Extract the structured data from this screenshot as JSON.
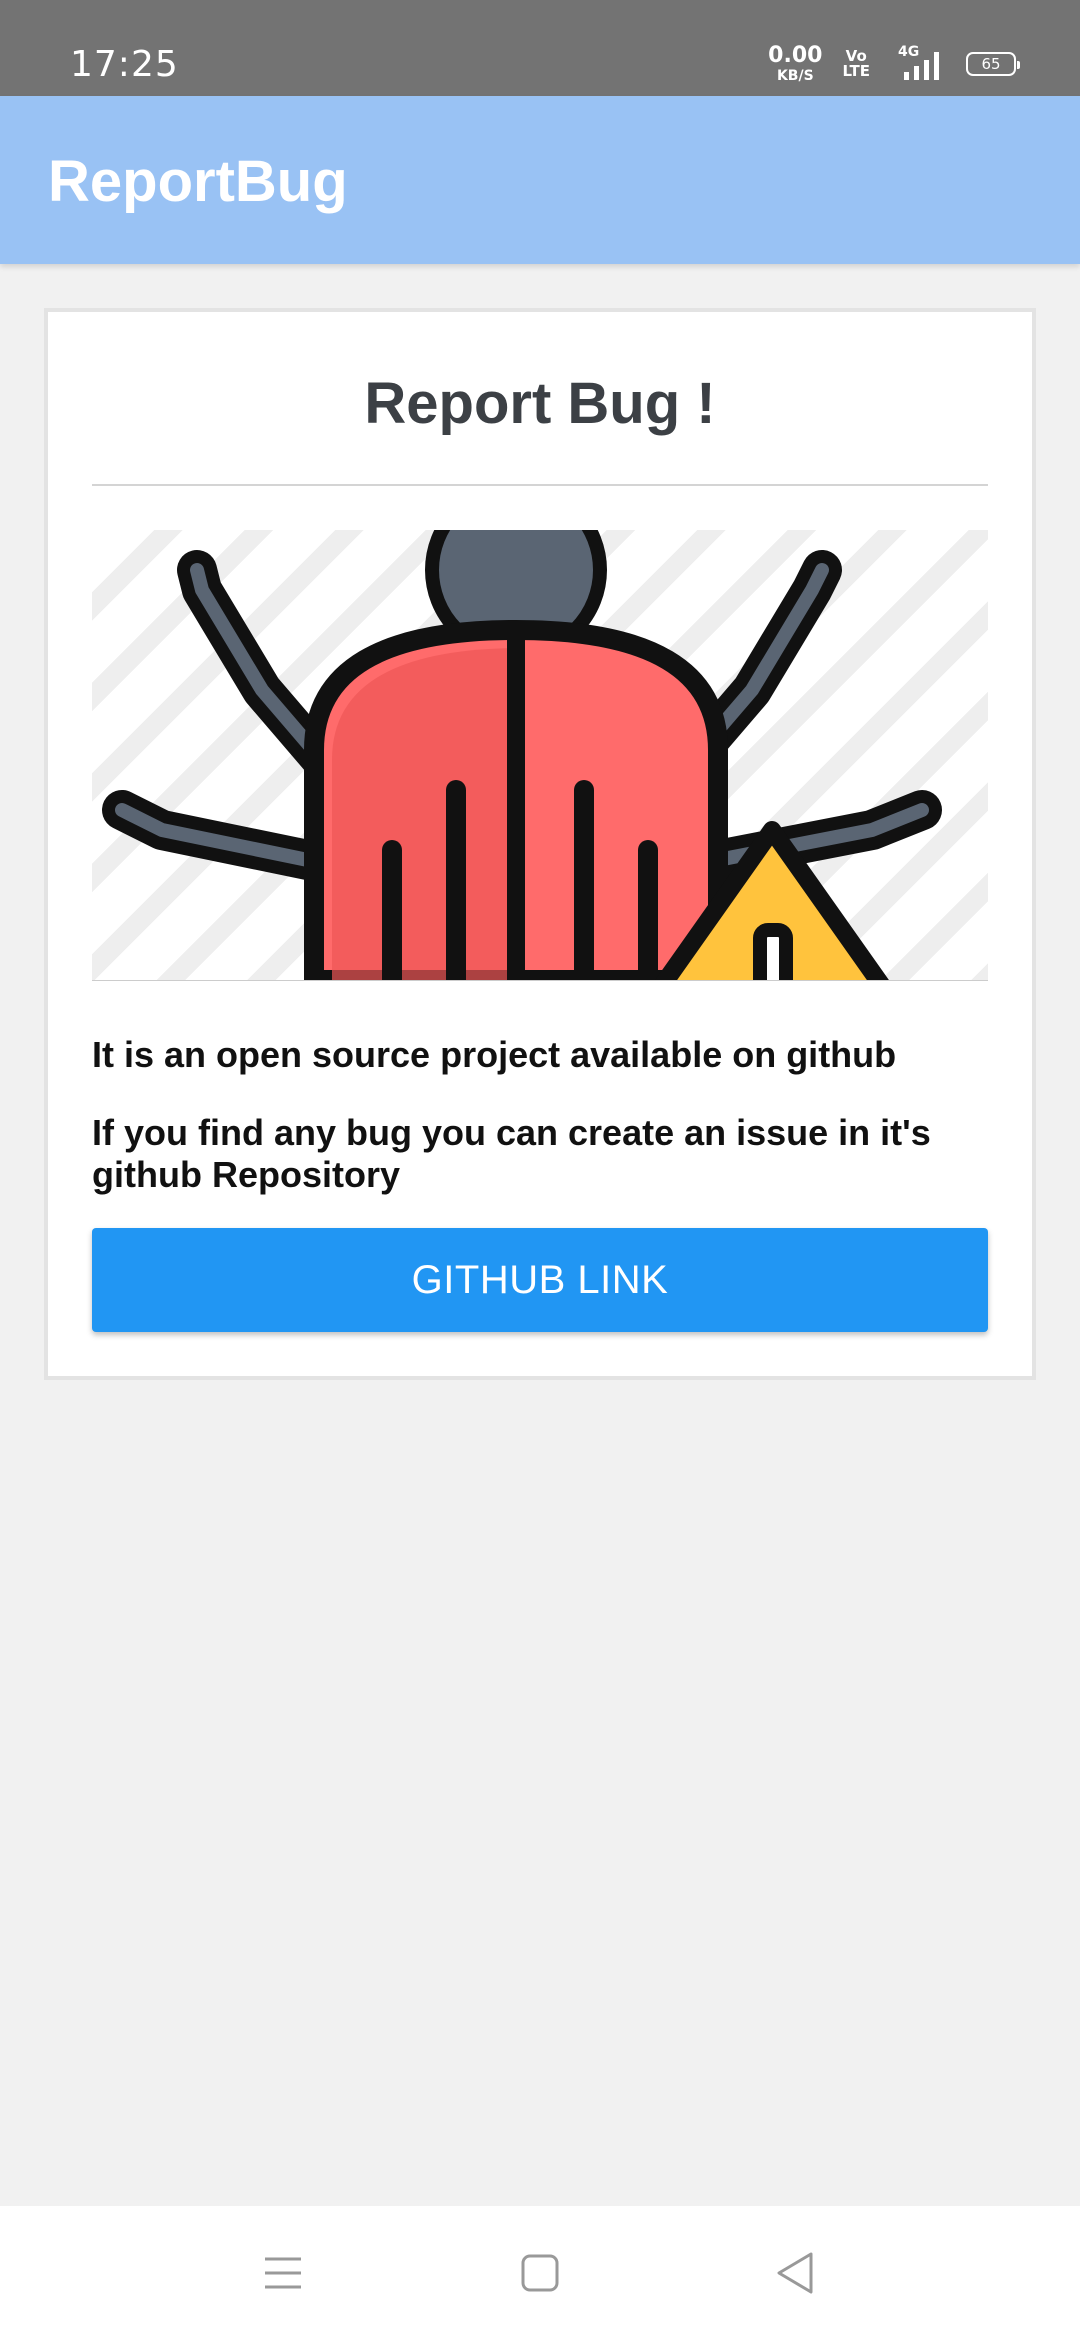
{
  "status_bar": {
    "time": "17:25",
    "net_speed_value": "0.00",
    "net_speed_unit": "KB/S",
    "volte_top": "Vo",
    "volte_bottom": "LTE",
    "network_type": "4G",
    "battery_level": "65"
  },
  "app_bar": {
    "title": "ReportBug"
  },
  "card": {
    "title": "Report Bug !",
    "text_1": "It is an open source project available on github",
    "text_2": "If you find any bug you can create an issue in it's github Repository",
    "button_label": "GITHUB LINK"
  },
  "colors": {
    "status_bar": "#737373",
    "app_bar": "#99c2f4",
    "button": "#2196f3",
    "background": "#f1f1f1"
  },
  "icons": {
    "bug_illustration": "bug-warning-illustration",
    "nav_recents": "menu-icon",
    "nav_home": "home-square-icon",
    "nav_back": "back-triangle-icon"
  }
}
